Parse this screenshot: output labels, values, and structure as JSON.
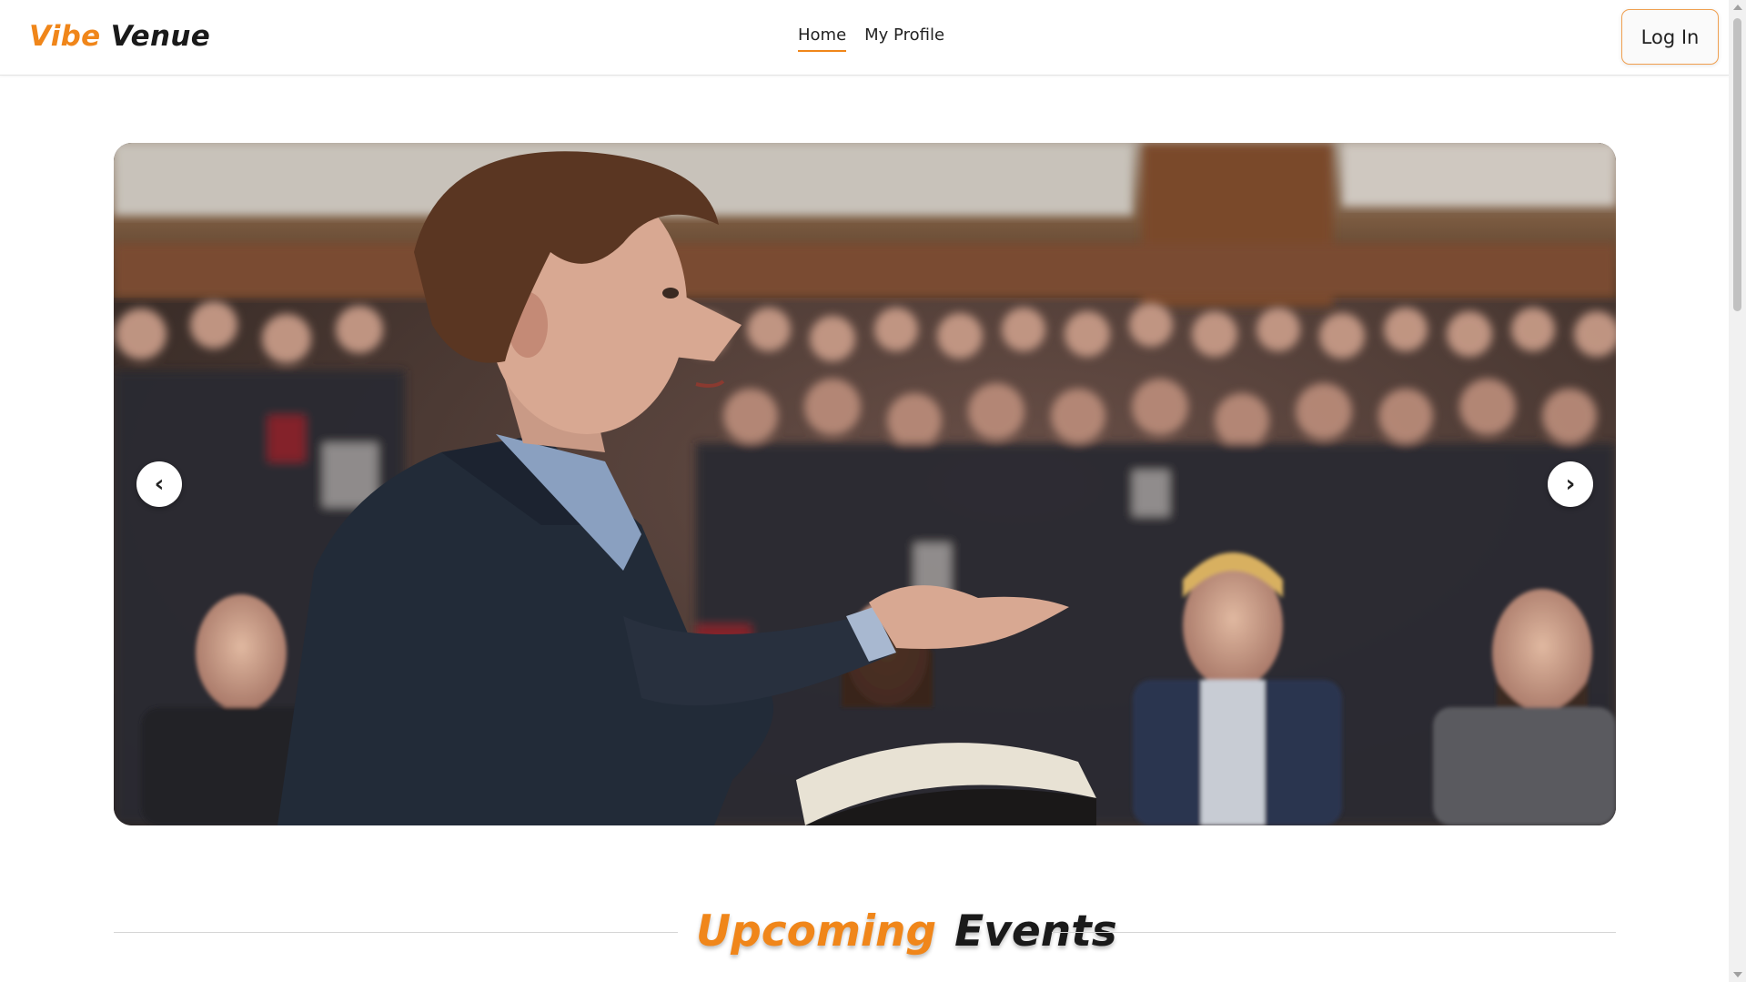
{
  "app": {
    "logo_part1": "Vibe",
    "logo_part2": "Venue"
  },
  "nav": {
    "items": [
      {
        "label": "Home",
        "active": true
      },
      {
        "label": "My Profile",
        "active": false
      }
    ],
    "login_label": "Log In"
  },
  "hero": {
    "image_icon": "speaker-audience-photo",
    "prev_label": "‹",
    "next_label": "›"
  },
  "section": {
    "title_part1": "Upcoming",
    "title_part2": "Events"
  },
  "colors": {
    "accent": "#f0861a",
    "text": "#1a1a1a",
    "border": "#e3e3e3"
  }
}
